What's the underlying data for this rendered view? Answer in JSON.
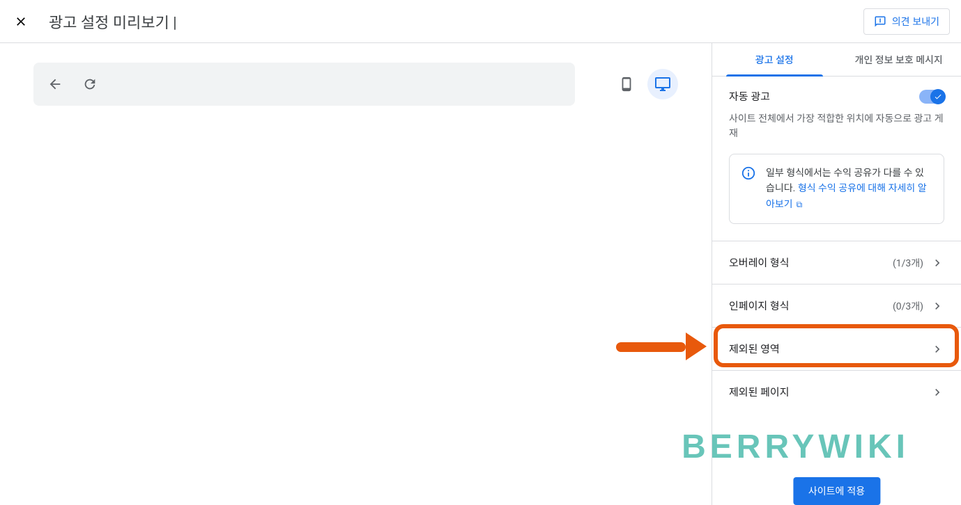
{
  "header": {
    "title": "광고 설정 미리보기 |",
    "feedback_label": "의견 보내기"
  },
  "panel": {
    "tabs": {
      "ad_settings": "광고 설정",
      "privacy_messages": "개인 정보 보호 메시지"
    },
    "auto_ads": {
      "label": "자동 광고",
      "description": "사이트 전체에서 가장 적합한 위치에 자동으로 광고 게재"
    },
    "info": {
      "text_before": "일부 형식에서는 수익 공유가 다를 수 있습니다. ",
      "link_text": "형식 수익 공유에 대해 자세히 알아보기"
    },
    "items": {
      "overlay": {
        "label": "오버레이 형식",
        "count": "(1/3개)"
      },
      "inpage": {
        "label": "인페이지 형식",
        "count": "(0/3개)"
      },
      "excluded_areas": {
        "label": "제외된 영역"
      },
      "excluded_pages": {
        "label": "제외된 페이지"
      }
    },
    "apply_label": "사이트에 적용"
  },
  "watermark": "BERRYWIKI"
}
